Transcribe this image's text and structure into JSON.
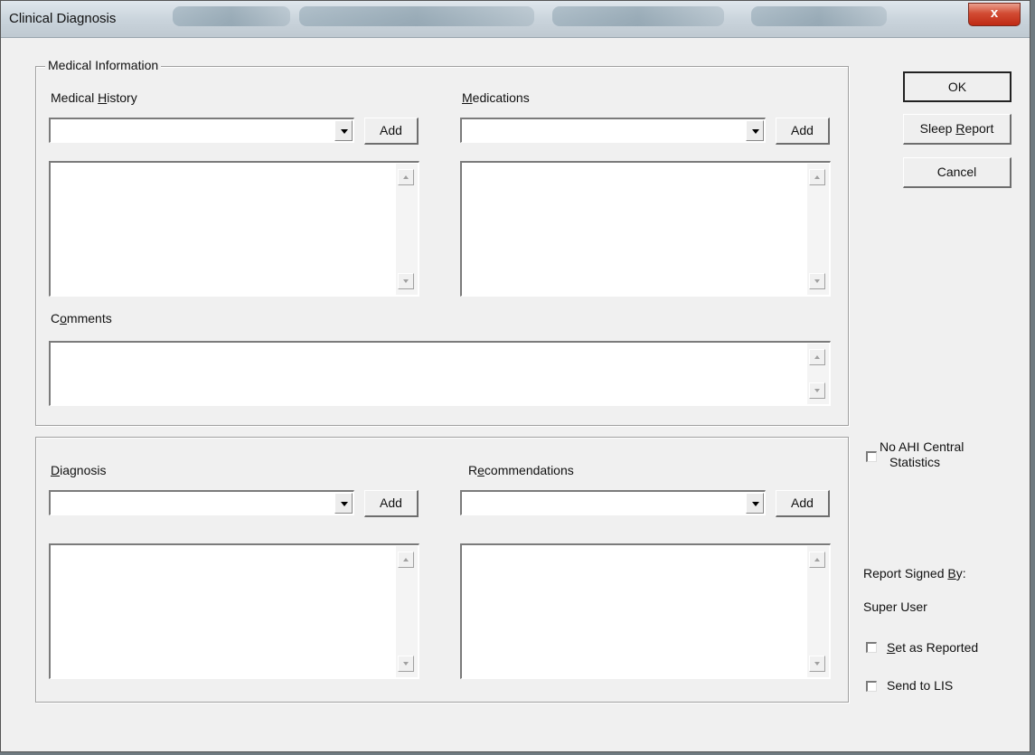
{
  "window": {
    "title": "Clinical Diagnosis",
    "close_label": "x"
  },
  "medical_information": {
    "group_label": "Medical Information",
    "medical_history": {
      "label": "Medical History",
      "add_label": "Add"
    },
    "medications": {
      "label": "Medications",
      "add_label": "Add"
    },
    "comments": {
      "label": "Comments"
    }
  },
  "diagnosis_section": {
    "diagnosis": {
      "label": "Diagnosis",
      "add_label": "Add"
    },
    "recommendations": {
      "label": "Recommendations",
      "add_label": "Add"
    }
  },
  "actions": {
    "ok_label": "OK",
    "sleep_report_label": "Sleep Report",
    "cancel_label": "Cancel"
  },
  "options": {
    "no_ahi_label_line1": "No AHI Central",
    "no_ahi_label_line2": "Statistics",
    "report_signed_by_label": "Report Signed By:",
    "signed_by_user": "Super User",
    "set_as_reported_label": "Set as Reported",
    "send_to_lis_label": "Send to LIS"
  }
}
